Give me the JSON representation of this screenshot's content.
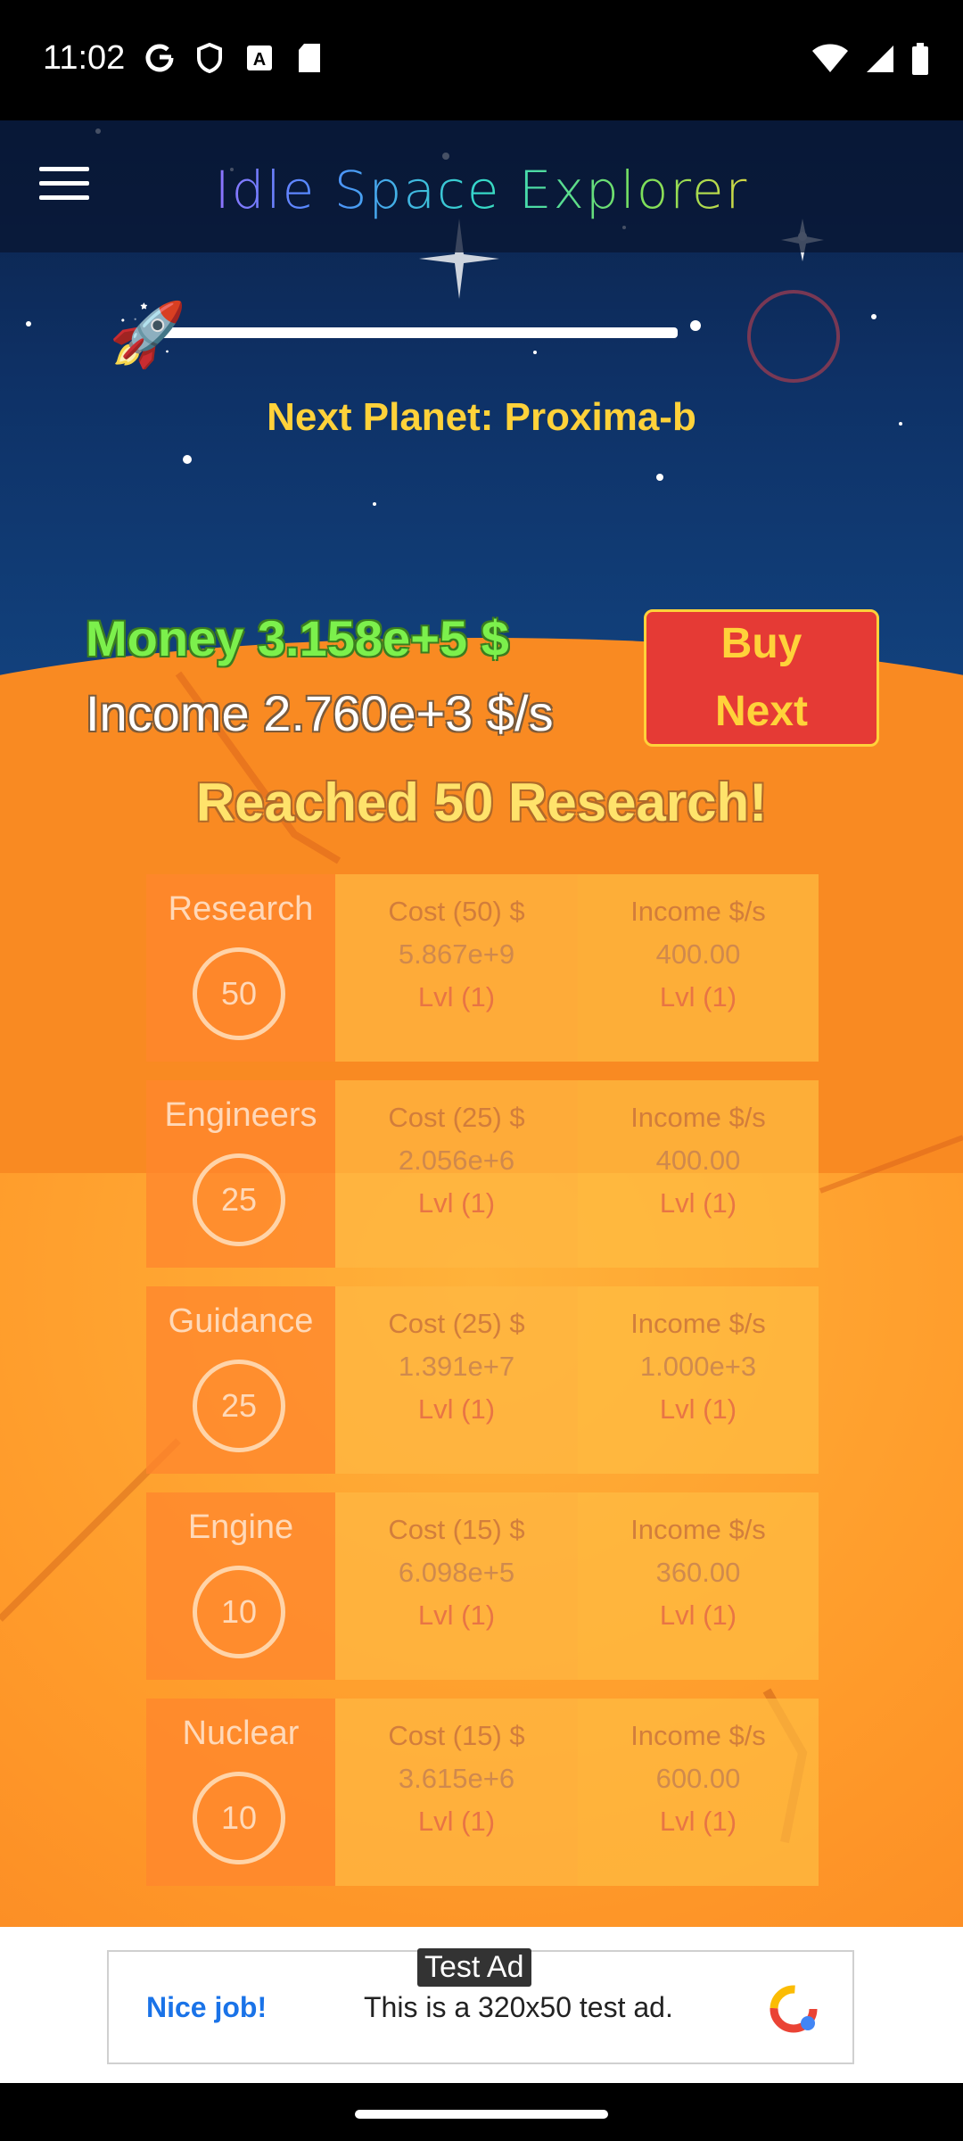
{
  "status_bar": {
    "time": "11:02",
    "left_icons": [
      "google-g-icon",
      "shield-icon",
      "font-a-icon",
      "sd-card-icon"
    ],
    "right_icons": [
      "wifi-icon",
      "signal-icon",
      "battery-icon"
    ]
  },
  "app": {
    "title": "Idle Space Explorer",
    "next_planet": "Next Planet: Proxima-b",
    "money": "Money 3.158e+5 $",
    "income": "Income 2.760e+3 $/s",
    "buy_next": [
      "Buy",
      "Next"
    ],
    "banner": "Reached 50 Research!",
    "progress_fraction": 1.0
  },
  "upgrades": [
    {
      "name": "Research",
      "level": "50",
      "cost_header": "Cost (50) $",
      "cost_value": "5.867e+9",
      "cost_lvl": "Lvl (1)",
      "income_header": "Income $/s",
      "income_value": "400.00",
      "income_lvl": "Lvl (1)"
    },
    {
      "name": "Engineers",
      "level": "25",
      "cost_header": "Cost (25) $",
      "cost_value": "2.056e+6",
      "cost_lvl": "Lvl (1)",
      "income_header": "Income $/s",
      "income_value": "400.00",
      "income_lvl": "Lvl (1)"
    },
    {
      "name": "Guidance",
      "level": "25",
      "cost_header": "Cost (25) $",
      "cost_value": "1.391e+7",
      "cost_lvl": "Lvl (1)",
      "income_header": "Income $/s",
      "income_value": "1.000e+3",
      "income_lvl": "Lvl (1)"
    },
    {
      "name": "Engine",
      "level": "10",
      "cost_header": "Cost (15) $",
      "cost_value": "6.098e+5",
      "cost_lvl": "Lvl (1)",
      "income_header": "Income $/s",
      "income_value": "360.00",
      "income_lvl": "Lvl (1)"
    },
    {
      "name": "Nuclear",
      "level": "10",
      "cost_header": "Cost (15) $",
      "cost_value": "3.615e+6",
      "cost_lvl": "Lvl (1)",
      "income_header": "Income $/s",
      "income_value": "600.00",
      "income_lvl": "Lvl (1)"
    }
  ],
  "ad": {
    "label": "Test Ad",
    "headline": "Nice job!",
    "text": "This is a 320x50 test ad."
  },
  "colors": {
    "money": "#7cf04c",
    "next_planet": "#ffd23a",
    "buy_button": "#e53a35",
    "ad_link": "#1a73e8"
  }
}
